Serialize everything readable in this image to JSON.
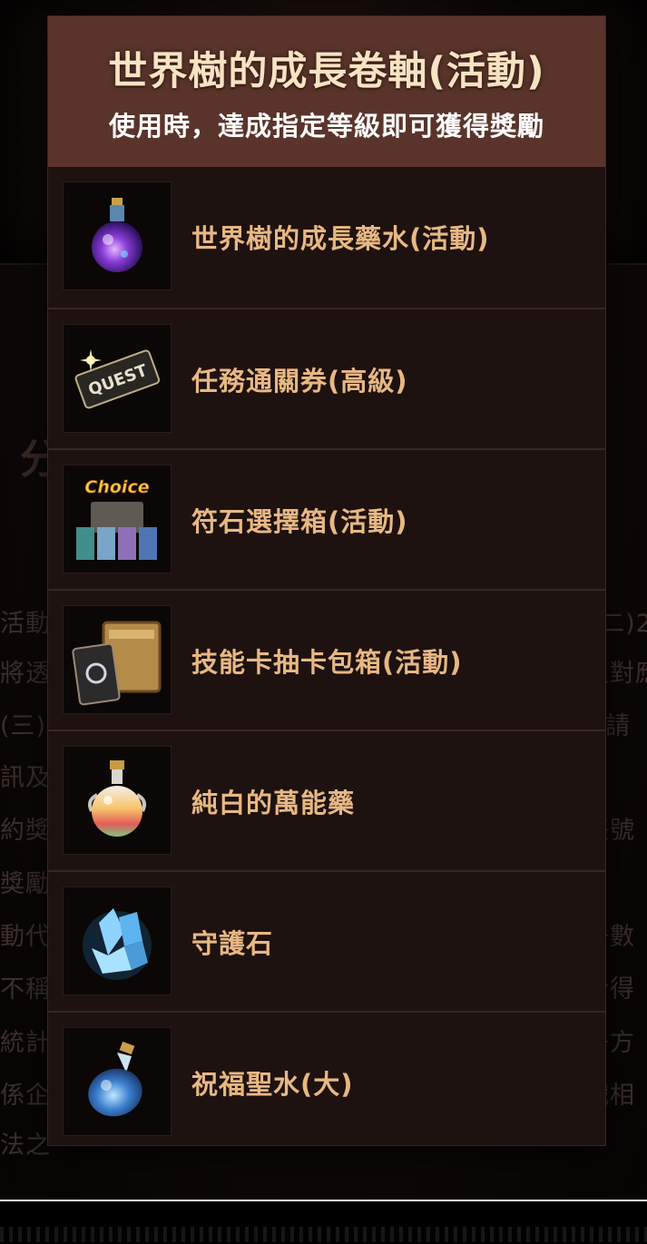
{
  "modal": {
    "title": "世界樹的成長卷軸(活動)",
    "subtitle": "使用時，達成指定等級即可獲得獎勵",
    "items": [
      {
        "label": "世界樹的成長藥水(活動)",
        "icon": "potion-icon"
      },
      {
        "label": "任務通關券(高級)",
        "icon": "quest-ticket-icon",
        "icon_text": "QUEST"
      },
      {
        "label": "符石選擇箱(活動)",
        "icon": "rune-choice-box-icon",
        "icon_text": "Choice"
      },
      {
        "label": "技能卡抽卡包箱(活動)",
        "icon": "skill-card-box-icon"
      },
      {
        "label": "純白的萬能藥",
        "icon": "white-elixir-icon"
      },
      {
        "label": "守護石",
        "icon": "guardian-stone-icon"
      },
      {
        "label": "祝福聖水(大)",
        "icon": "holy-water-icon"
      }
    ]
  },
  "colors": {
    "header_bg": "#5a342b",
    "panel_bg": "#1e1210",
    "title_text": "#f7e3c2",
    "item_text": "#e8b883"
  }
}
